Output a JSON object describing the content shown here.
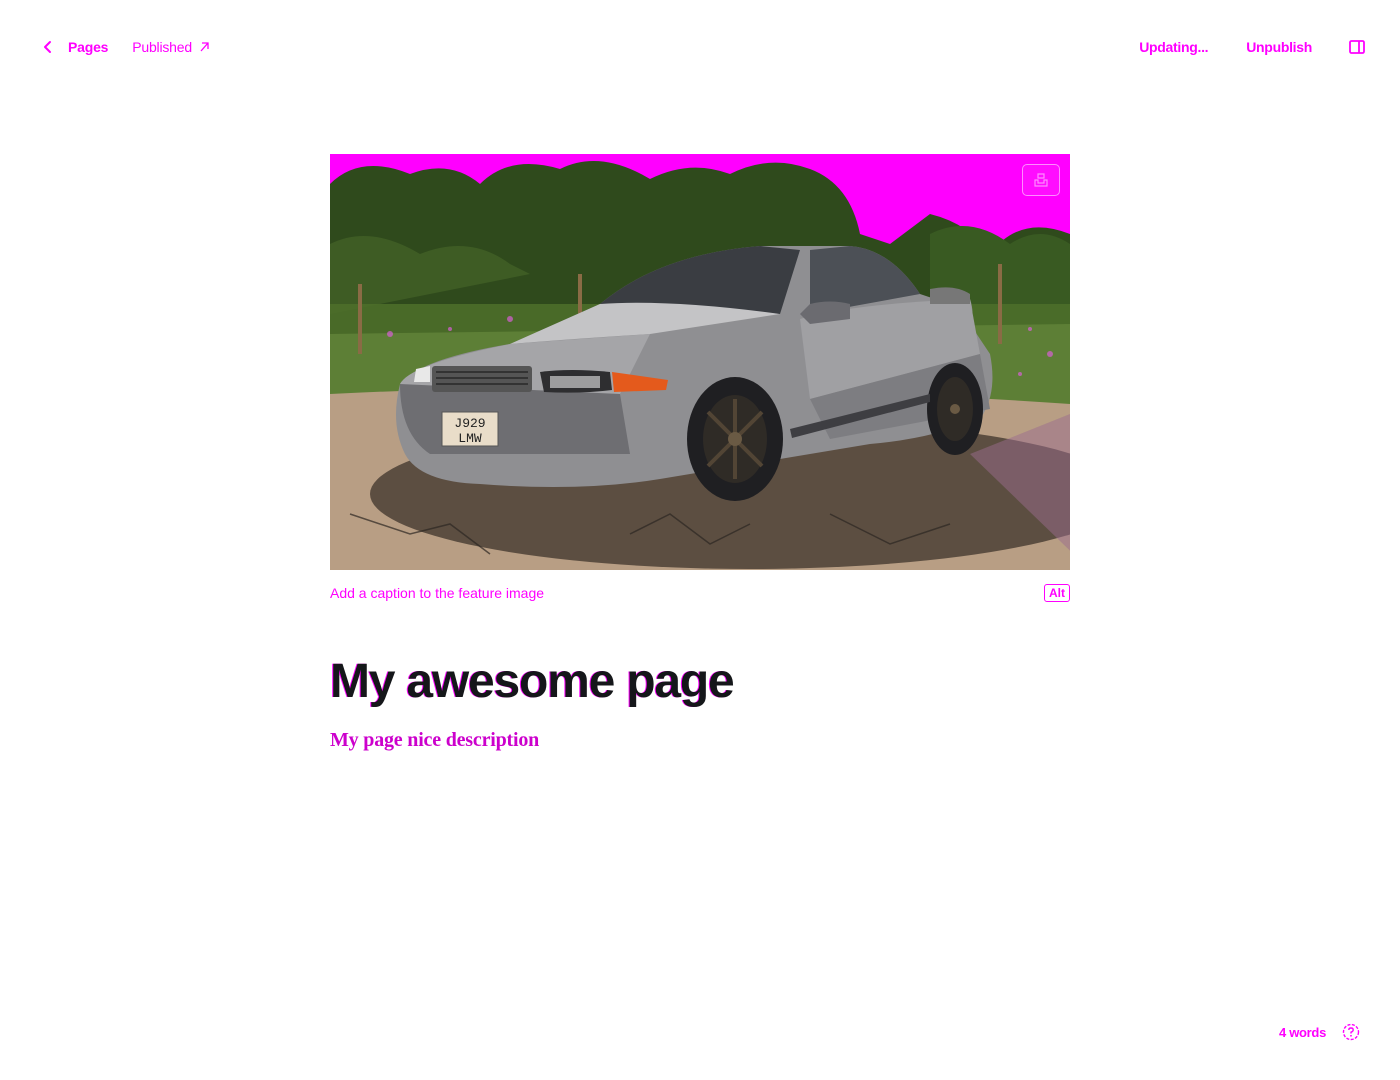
{
  "header": {
    "back_label": "Pages",
    "published_label": "Published",
    "status_text": "Updating...",
    "unpublish_label": "Unpublish"
  },
  "editor": {
    "feature_image": {
      "alt_label": "Alt",
      "caption_placeholder": "Add a caption to the feature image",
      "plate_line1": "J929",
      "plate_line2": "LMW"
    },
    "title": "My awesome page",
    "excerpt": "My page nice description"
  },
  "footer": {
    "word_count": "4 words"
  },
  "icons": {
    "back": "chevron-left-icon",
    "external": "external-link-icon",
    "sidebar": "sidebar-toggle-icon",
    "image_action": "unsplash-icon",
    "help": "help-circle-icon"
  },
  "colors": {
    "accent": "#ff00ff",
    "title": "#15171a",
    "background": "#ffffff"
  }
}
